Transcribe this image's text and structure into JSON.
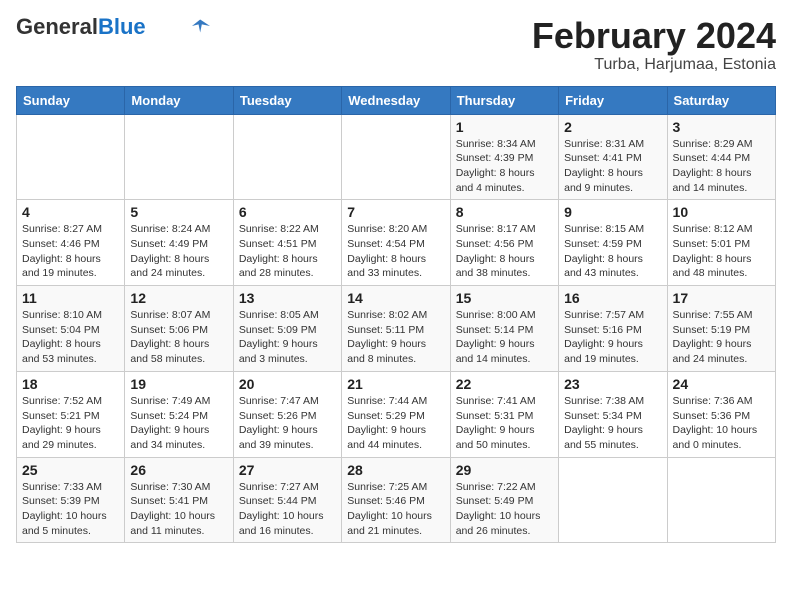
{
  "header": {
    "logo_general": "General",
    "logo_blue": "Blue",
    "month_year": "February 2024",
    "location": "Turba, Harjumaa, Estonia"
  },
  "days_of_week": [
    "Sunday",
    "Monday",
    "Tuesday",
    "Wednesday",
    "Thursday",
    "Friday",
    "Saturday"
  ],
  "weeks": [
    [
      {
        "day": "",
        "info": ""
      },
      {
        "day": "",
        "info": ""
      },
      {
        "day": "",
        "info": ""
      },
      {
        "day": "",
        "info": ""
      },
      {
        "day": "1",
        "info": "Sunrise: 8:34 AM\nSunset: 4:39 PM\nDaylight: 8 hours\nand 4 minutes."
      },
      {
        "day": "2",
        "info": "Sunrise: 8:31 AM\nSunset: 4:41 PM\nDaylight: 8 hours\nand 9 minutes."
      },
      {
        "day": "3",
        "info": "Sunrise: 8:29 AM\nSunset: 4:44 PM\nDaylight: 8 hours\nand 14 minutes."
      }
    ],
    [
      {
        "day": "4",
        "info": "Sunrise: 8:27 AM\nSunset: 4:46 PM\nDaylight: 8 hours\nand 19 minutes."
      },
      {
        "day": "5",
        "info": "Sunrise: 8:24 AM\nSunset: 4:49 PM\nDaylight: 8 hours\nand 24 minutes."
      },
      {
        "day": "6",
        "info": "Sunrise: 8:22 AM\nSunset: 4:51 PM\nDaylight: 8 hours\nand 28 minutes."
      },
      {
        "day": "7",
        "info": "Sunrise: 8:20 AM\nSunset: 4:54 PM\nDaylight: 8 hours\nand 33 minutes."
      },
      {
        "day": "8",
        "info": "Sunrise: 8:17 AM\nSunset: 4:56 PM\nDaylight: 8 hours\nand 38 minutes."
      },
      {
        "day": "9",
        "info": "Sunrise: 8:15 AM\nSunset: 4:59 PM\nDaylight: 8 hours\nand 43 minutes."
      },
      {
        "day": "10",
        "info": "Sunrise: 8:12 AM\nSunset: 5:01 PM\nDaylight: 8 hours\nand 48 minutes."
      }
    ],
    [
      {
        "day": "11",
        "info": "Sunrise: 8:10 AM\nSunset: 5:04 PM\nDaylight: 8 hours\nand 53 minutes."
      },
      {
        "day": "12",
        "info": "Sunrise: 8:07 AM\nSunset: 5:06 PM\nDaylight: 8 hours\nand 58 minutes."
      },
      {
        "day": "13",
        "info": "Sunrise: 8:05 AM\nSunset: 5:09 PM\nDaylight: 9 hours\nand 3 minutes."
      },
      {
        "day": "14",
        "info": "Sunrise: 8:02 AM\nSunset: 5:11 PM\nDaylight: 9 hours\nand 8 minutes."
      },
      {
        "day": "15",
        "info": "Sunrise: 8:00 AM\nSunset: 5:14 PM\nDaylight: 9 hours\nand 14 minutes."
      },
      {
        "day": "16",
        "info": "Sunrise: 7:57 AM\nSunset: 5:16 PM\nDaylight: 9 hours\nand 19 minutes."
      },
      {
        "day": "17",
        "info": "Sunrise: 7:55 AM\nSunset: 5:19 PM\nDaylight: 9 hours\nand 24 minutes."
      }
    ],
    [
      {
        "day": "18",
        "info": "Sunrise: 7:52 AM\nSunset: 5:21 PM\nDaylight: 9 hours\nand 29 minutes."
      },
      {
        "day": "19",
        "info": "Sunrise: 7:49 AM\nSunset: 5:24 PM\nDaylight: 9 hours\nand 34 minutes."
      },
      {
        "day": "20",
        "info": "Sunrise: 7:47 AM\nSunset: 5:26 PM\nDaylight: 9 hours\nand 39 minutes."
      },
      {
        "day": "21",
        "info": "Sunrise: 7:44 AM\nSunset: 5:29 PM\nDaylight: 9 hours\nand 44 minutes."
      },
      {
        "day": "22",
        "info": "Sunrise: 7:41 AM\nSunset: 5:31 PM\nDaylight: 9 hours\nand 50 minutes."
      },
      {
        "day": "23",
        "info": "Sunrise: 7:38 AM\nSunset: 5:34 PM\nDaylight: 9 hours\nand 55 minutes."
      },
      {
        "day": "24",
        "info": "Sunrise: 7:36 AM\nSunset: 5:36 PM\nDaylight: 10 hours\nand 0 minutes."
      }
    ],
    [
      {
        "day": "25",
        "info": "Sunrise: 7:33 AM\nSunset: 5:39 PM\nDaylight: 10 hours\nand 5 minutes."
      },
      {
        "day": "26",
        "info": "Sunrise: 7:30 AM\nSunset: 5:41 PM\nDaylight: 10 hours\nand 11 minutes."
      },
      {
        "day": "27",
        "info": "Sunrise: 7:27 AM\nSunset: 5:44 PM\nDaylight: 10 hours\nand 16 minutes."
      },
      {
        "day": "28",
        "info": "Sunrise: 7:25 AM\nSunset: 5:46 PM\nDaylight: 10 hours\nand 21 minutes."
      },
      {
        "day": "29",
        "info": "Sunrise: 7:22 AM\nSunset: 5:49 PM\nDaylight: 10 hours\nand 26 minutes."
      },
      {
        "day": "",
        "info": ""
      },
      {
        "day": "",
        "info": ""
      }
    ]
  ]
}
